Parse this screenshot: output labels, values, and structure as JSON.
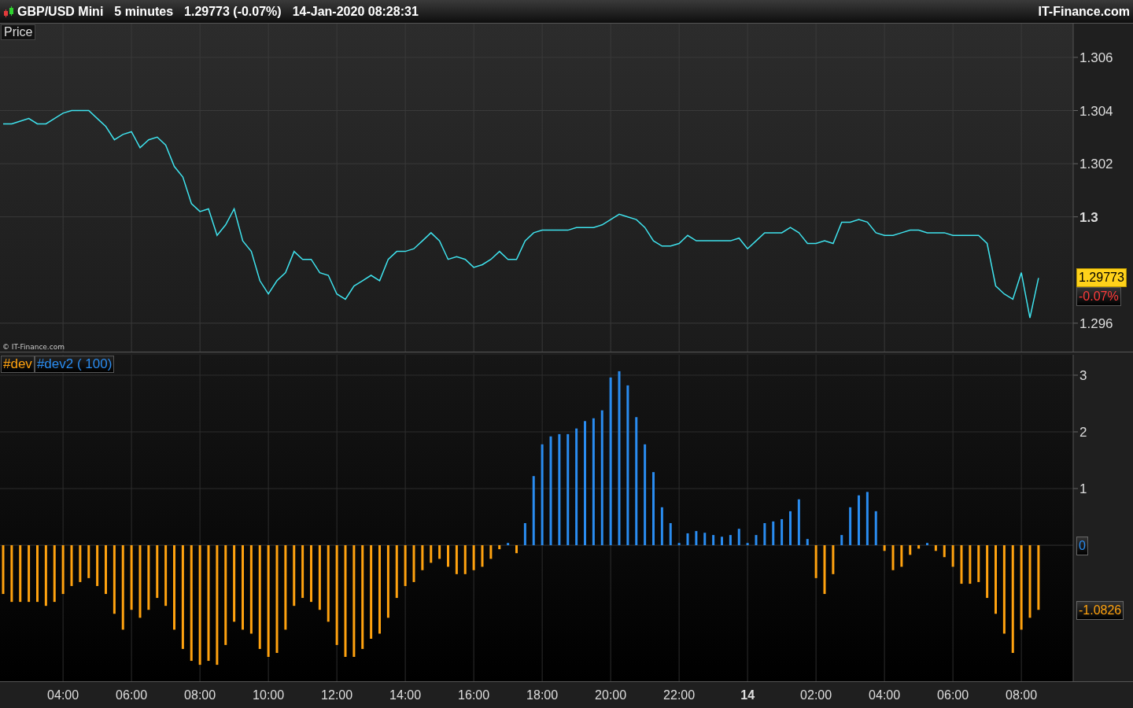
{
  "header": {
    "symbol": "GBP/USD Mini",
    "interval": "5 minutes",
    "quote": "1.29773 (-0.07%)",
    "datetime": "14-Jan-2020 08:28:31",
    "brand": "IT-Finance.com"
  },
  "price_panel": {
    "copyright": "© IT-Finance.com",
    "badges": [
      {
        "kind": "price",
        "label": "1.29773"
      },
      {
        "kind": "change",
        "label": "-0.07%"
      }
    ],
    "chart_data": {
      "type": "line",
      "title": "Price",
      "grid": true,
      "ylim": [
        1.29493,
        1.30727
      ],
      "yticks": [
        1.296,
        1.3,
        1.302,
        1.304,
        1.306
      ],
      "series": [
        {
          "color": "#3fe3ee",
          "values": [
            1.3035,
            1.3035,
            1.3036,
            1.3037,
            1.3035,
            1.3035,
            1.3037,
            1.3039,
            1.304,
            1.304,
            1.304,
            1.3037,
            1.3034,
            1.3029,
            1.3031,
            1.3032,
            1.3026,
            1.3029,
            1.303,
            1.3027,
            1.3019,
            1.3015,
            1.3005,
            1.3002,
            1.3003,
            1.2993,
            1.2997,
            1.3003,
            1.2991,
            1.2987,
            1.2976,
            1.2971,
            1.2976,
            1.2979,
            1.2987,
            1.2984,
            1.2984,
            1.2979,
            1.2978,
            1.2971,
            1.2969,
            1.2974,
            1.2976,
            1.2978,
            1.2976,
            1.2984,
            1.2987,
            1.2987,
            1.2988,
            1.2991,
            1.2994,
            1.2991,
            1.2984,
            1.2985,
            1.2984,
            1.2981,
            1.2982,
            1.2984,
            1.2987,
            1.2984,
            1.2984,
            1.2991,
            1.2994,
            1.2995,
            1.2995,
            1.2995,
            1.2995,
            1.2996,
            1.2996,
            1.2996,
            1.2997,
            1.2999,
            1.3001,
            1.3,
            1.2999,
            1.2996,
            1.2991,
            1.2989,
            1.2989,
            1.299,
            1.2993,
            1.2991,
            1.2991,
            1.2991,
            1.2991,
            1.2991,
            1.2992,
            1.2988,
            1.2991,
            1.2994,
            1.2994,
            1.2994,
            1.2996,
            1.2994,
            1.299,
            1.299,
            1.2991,
            1.299,
            1.2998,
            1.2998,
            1.2999,
            1.2998,
            1.2994,
            1.2993,
            1.2993,
            1.2994,
            1.2995,
            1.2995,
            1.2994,
            1.2994,
            1.2994,
            1.2993,
            1.2993,
            1.2993,
            1.2993,
            1.299,
            1.2974,
            1.2971,
            1.2969,
            1.2979,
            1.2962,
            1.2977
          ]
        }
      ]
    }
  },
  "indicator_panel": {
    "badges": [
      {
        "label": "0",
        "color": "#2a8cf0"
      },
      {
        "label": "-1.0826",
        "color": "#ffa20f"
      }
    ],
    "chart_data": {
      "type": "bar",
      "grid": true,
      "ylim": [
        -2.4,
        3.36
      ],
      "yticks": [
        {
          "value": 1,
          "label": "1"
        },
        {
          "value": 2,
          "label": "2"
        },
        {
          "value": 3,
          "label": "3"
        }
      ],
      "series": [
        {
          "name": "#dev",
          "color": "#ffa20f",
          "values": [
            -0.86,
            -1.0,
            -1.0,
            -1.0,
            -1.0,
            -1.07,
            -1.0,
            -0.86,
            -0.72,
            -0.65,
            -0.58,
            -0.72,
            -0.86,
            -1.21,
            -1.49,
            -1.14,
            -1.28,
            -1.14,
            -0.93,
            -1.07,
            -1.49,
            -1.83,
            -2.04,
            -2.11,
            -2.04,
            -2.11,
            -1.76,
            -1.35,
            -1.49,
            -1.56,
            -1.83,
            -1.97,
            -1.9,
            -1.49,
            -1.07,
            -0.93,
            -1.0,
            -1.14,
            -1.35,
            -1.76,
            -1.97,
            -1.97,
            -1.83,
            -1.65,
            -1.56,
            -1.28,
            -0.93,
            -0.72,
            -0.65,
            -0.44,
            -0.31,
            -0.24,
            -0.38,
            -0.51,
            -0.51,
            -0.44,
            -0.38,
            -0.24,
            -0.07,
            null,
            -0.14,
            null,
            null,
            null,
            null,
            null,
            null,
            null,
            null,
            null,
            null,
            null,
            null,
            null,
            null,
            null,
            null,
            null,
            null,
            null,
            null,
            null,
            null,
            null,
            null,
            null,
            null,
            null,
            null,
            null,
            null,
            null,
            null,
            null,
            null,
            -0.58,
            -0.86,
            -0.51,
            null,
            null,
            null,
            null,
            null,
            -0.1,
            -0.44,
            -0.38,
            -0.17,
            -0.06,
            null,
            -0.1,
            -0.21,
            -0.38,
            -0.68,
            -0.68,
            -0.65,
            -0.93,
            -1.21,
            -1.56,
            -1.9,
            -1.49,
            -1.28,
            -1.14
          ]
        },
        {
          "name": "#dev2 ( 100)",
          "color": "#2a8cf0",
          "values": [
            null,
            null,
            null,
            null,
            null,
            null,
            null,
            null,
            null,
            null,
            null,
            null,
            null,
            null,
            null,
            null,
            null,
            null,
            null,
            null,
            null,
            null,
            null,
            null,
            null,
            null,
            null,
            null,
            null,
            null,
            null,
            null,
            null,
            null,
            null,
            null,
            null,
            null,
            null,
            null,
            null,
            null,
            null,
            null,
            null,
            null,
            null,
            null,
            null,
            null,
            null,
            null,
            null,
            null,
            null,
            null,
            null,
            null,
            null,
            0.04,
            null,
            0.39,
            1.22,
            1.78,
            1.92,
            1.96,
            1.96,
            2.06,
            2.19,
            2.24,
            2.38,
            2.96,
            3.07,
            2.82,
            2.26,
            1.78,
            1.29,
            0.67,
            0.39,
            0.04,
            0.21,
            0.25,
            0.22,
            0.18,
            0.15,
            0.18,
            0.29,
            0.04,
            0.18,
            0.39,
            0.42,
            0.46,
            0.6,
            0.81,
            0.11,
            null,
            null,
            null,
            0.18,
            0.67,
            0.88,
            0.94,
            0.6,
            null,
            null,
            null,
            null,
            null,
            0.04,
            null,
            null,
            null,
            null,
            null,
            null,
            null,
            null,
            null,
            null,
            null,
            null,
            null
          ]
        }
      ]
    }
  },
  "time_axis": [
    {
      "label": "04:00",
      "kind": "time"
    },
    {
      "label": "06:00",
      "kind": "time"
    },
    {
      "label": "08:00",
      "kind": "time"
    },
    {
      "label": "10:00",
      "kind": "time"
    },
    {
      "label": "12:00",
      "kind": "time"
    },
    {
      "label": "14:00",
      "kind": "time"
    },
    {
      "label": "16:00",
      "kind": "time"
    },
    {
      "label": "18:00",
      "kind": "time"
    },
    {
      "label": "20:00",
      "kind": "time"
    },
    {
      "label": "22:00",
      "kind": "time"
    },
    {
      "label": "14",
      "kind": "day"
    },
    {
      "label": "02:00",
      "kind": "time"
    },
    {
      "label": "04:00",
      "kind": "time"
    },
    {
      "label": "06:00",
      "kind": "time"
    },
    {
      "label": "08:00",
      "kind": "time"
    }
  ]
}
